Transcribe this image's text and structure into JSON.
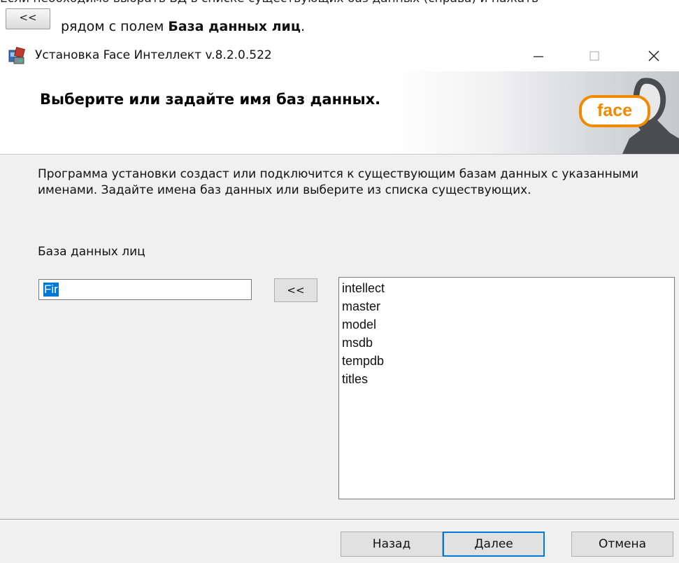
{
  "doc": {
    "cut_text": "Если необходимо выбрать БД в списке существующих баз данных (справа) и нажать",
    "inline_button": "<<",
    "line_prefix": "рядом с полем ",
    "line_bold": "База данных лиц",
    "line_suffix": "."
  },
  "window": {
    "title": "Установка Face Интеллект v.8.2.0.522",
    "icon": "installer-icon",
    "controls": {
      "minimize": "minimize-icon",
      "maximize": "maximize-icon",
      "close": "close-icon"
    }
  },
  "banner": {
    "heading": "Выберите или задайте имя баз данных.",
    "logo_text": "face"
  },
  "body": {
    "description": "Программа установки создаст или подключится к существующим базам данных с указанными именами. Задайте имена баз данных или выберите из списка существующих.",
    "db_label": "База данных лиц",
    "db_value": "Fir",
    "pick_button": "<<",
    "databases": [
      "intellect",
      "master",
      "model",
      "msdb",
      "tempdb",
      "titles"
    ]
  },
  "footer": {
    "back": "Назад",
    "next": "Далее",
    "cancel": "Отмена"
  },
  "colors": {
    "accent": "#0078d7",
    "logo": "#f08a00",
    "dialog_bg": "#f0f0f0"
  }
}
